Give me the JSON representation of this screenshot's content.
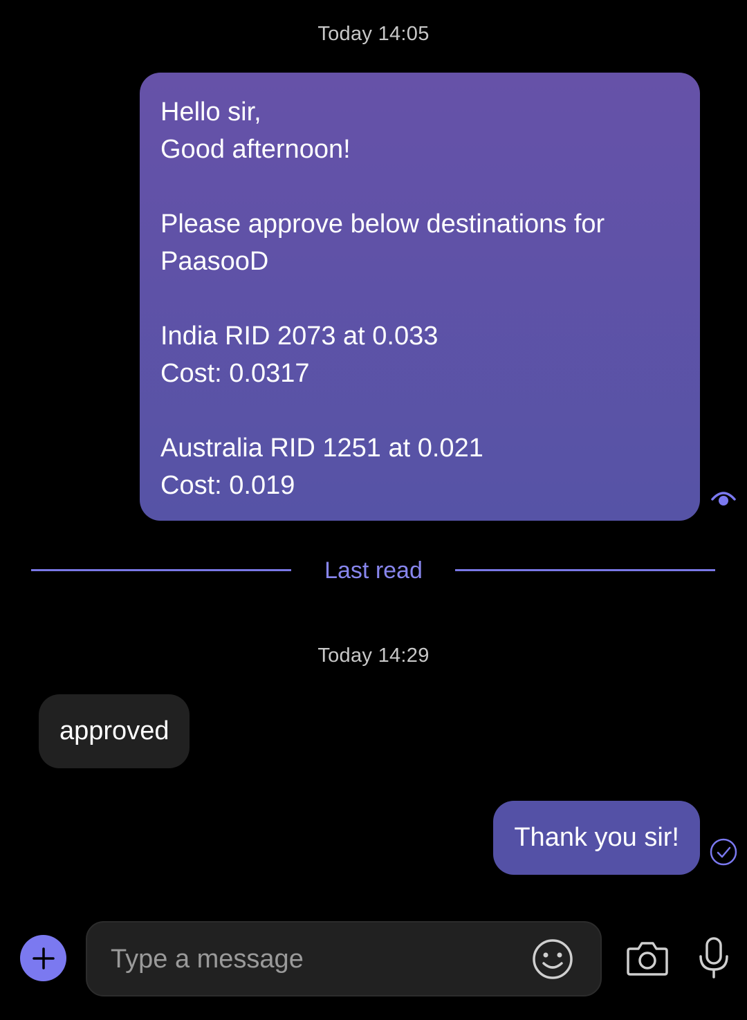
{
  "conversation": {
    "messages": [
      {
        "timestamp": "Today 14:05",
        "direction": "outgoing",
        "lines": [
          "Hello sir,",
          "Good afternoon!",
          "",
          "Please approve below destinations for",
          "PaasooD",
          "",
          "India RID 2073 at 0.033",
          "Cost: 0.0317",
          "",
          "Australia RID 1251 at 0.021",
          "Cost: 0.019"
        ],
        "status_icon": "seen-eye-icon"
      },
      {
        "timestamp": "Today 14:29",
        "direction": "incoming",
        "text": "approved"
      },
      {
        "direction": "outgoing",
        "text": "Thank you sir!",
        "status_icon": "delivered-check-icon"
      }
    ],
    "divider_label": "Last read"
  },
  "composer": {
    "placeholder": "Type a message",
    "value": "",
    "icons": [
      "plus-icon",
      "emoji-icon",
      "camera-icon",
      "microphone-icon"
    ]
  },
  "colors": {
    "background": "#000000",
    "outgoing_bubble": "#5a52a6",
    "incoming_bubble": "#212121",
    "accent": "#7b79f0",
    "timestamp": "#c8c8c8"
  }
}
